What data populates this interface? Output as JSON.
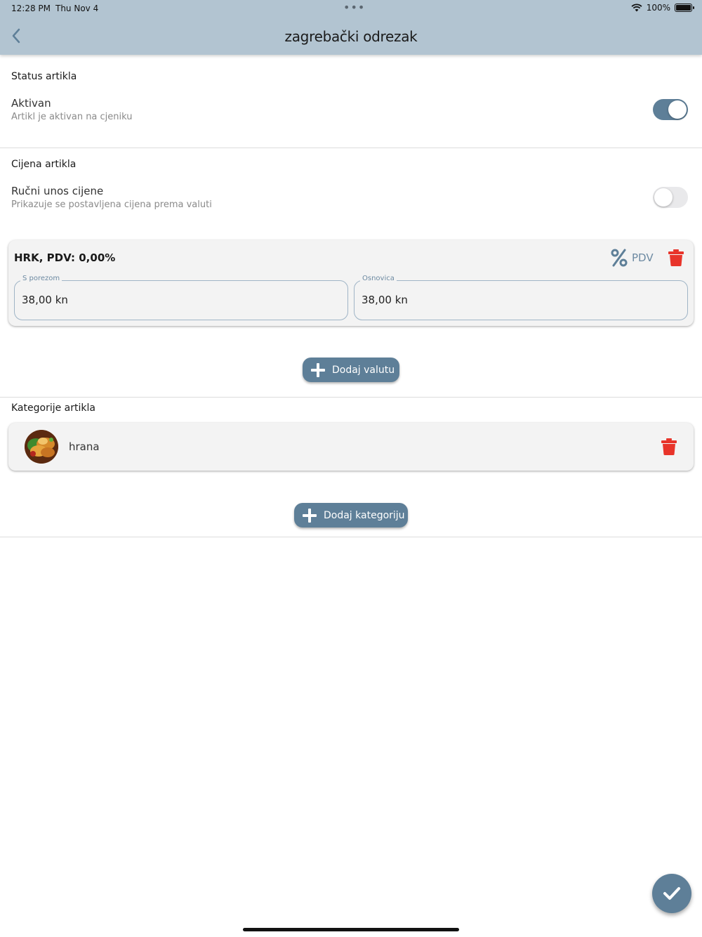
{
  "status_bar": {
    "time": "12:28 PM",
    "date": "Thu Nov 4",
    "dots": "•••",
    "battery": "100%"
  },
  "header": {
    "title": "zagrebački odrezak"
  },
  "status_section": {
    "title": "Status artikla",
    "label": "Aktivan",
    "sublabel": "Artikl je aktivan na cjeniku",
    "toggle_on": true
  },
  "price_section": {
    "title": "Cijena artikla",
    "label": "Ručni unos cijene",
    "sublabel": "Prikazuje se postavljena cijena prema valuti",
    "toggle_on": false,
    "card": {
      "title": "HRK, PDV: 0,00%",
      "pdv_label": "PDV",
      "with_tax_label": "S porezom",
      "with_tax_value": "38,00 kn",
      "base_label": "Osnovica",
      "base_value": "38,00 kn"
    },
    "add_button": "Dodaj valutu"
  },
  "category_section": {
    "title": "Kategorije artikla",
    "items": [
      {
        "name": "hrana"
      }
    ],
    "add_button": "Dodaj kategoriju"
  },
  "colors": {
    "header": "#b2c4d1",
    "accent": "#5e7f98",
    "delete": "#e8342a"
  },
  "icons": {
    "back": "chevron-left-icon",
    "percent": "percent-icon",
    "delete": "trash-icon",
    "add": "plus-icon",
    "confirm": "check-icon"
  }
}
